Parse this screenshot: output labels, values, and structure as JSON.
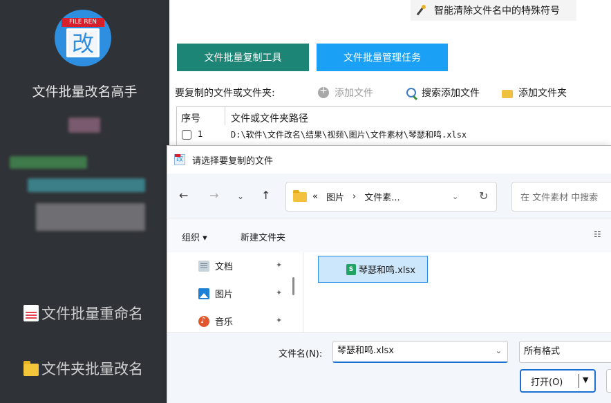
{
  "sidebar": {
    "app_title": "文件批量改名高手",
    "logo_tag": "FILE REN",
    "logo_glyph": "改",
    "items": [
      {
        "label": "文件批量重命名",
        "icon": "document-icon"
      },
      {
        "label": "文件夹批量改名",
        "icon": "folder-icon"
      }
    ]
  },
  "top_hint": {
    "label": "智能清除文件名中的特殊符号",
    "icon": "magic-wand-icon"
  },
  "tabs": [
    {
      "label": "文件批量复制工具",
      "active": true,
      "color": "#1d8576"
    },
    {
      "label": "文件批量管理任务",
      "active": false,
      "color": "#1aa0f5"
    }
  ],
  "toolbar": {
    "source_label": "要复制的文件或文件夹:",
    "add_file": "添加文件",
    "search_add_file": "搜索添加文件",
    "add_folder": "添加文件夹"
  },
  "file_table": {
    "columns": [
      "序号",
      "文件或文件夹路径"
    ],
    "rows": [
      {
        "no": "1",
        "path": "D:\\软件\\文件改名\\结果\\视频\\图片\\文件素材\\琴瑟和鸣.xlsx"
      }
    ]
  },
  "dialog": {
    "title": "请选择要复制的文件",
    "nav": {
      "back": "←",
      "forward": "→",
      "recent": "⌄",
      "up": "↑"
    },
    "address": {
      "prefix": "«",
      "segments": [
        "图片",
        "›",
        "文件素..."
      ],
      "dropdown": "⌄",
      "refresh": "↻"
    },
    "search_placeholder": "在 文件素材 中搜索",
    "commands": {
      "organize": "组织 ▾",
      "new_folder": "新建文件夹",
      "view": "☷"
    },
    "nav_pane": [
      {
        "label": "文档",
        "icon": "documents-icon"
      },
      {
        "label": "图片",
        "icon": "pictures-icon"
      },
      {
        "label": "音乐",
        "icon": "music-icon"
      }
    ],
    "pin_glyph": "✦",
    "files": [
      {
        "name": "琴瑟和鸣.xlsx",
        "badge": "S",
        "selected": true
      }
    ],
    "filename_label": "文件名(N):",
    "filename_value": "琴瑟和鸣.xlsx",
    "dropdown_glyph": "⌄",
    "filetype_value": "所有格式",
    "open_button": "打开(O)",
    "open_arrow": "▼"
  }
}
